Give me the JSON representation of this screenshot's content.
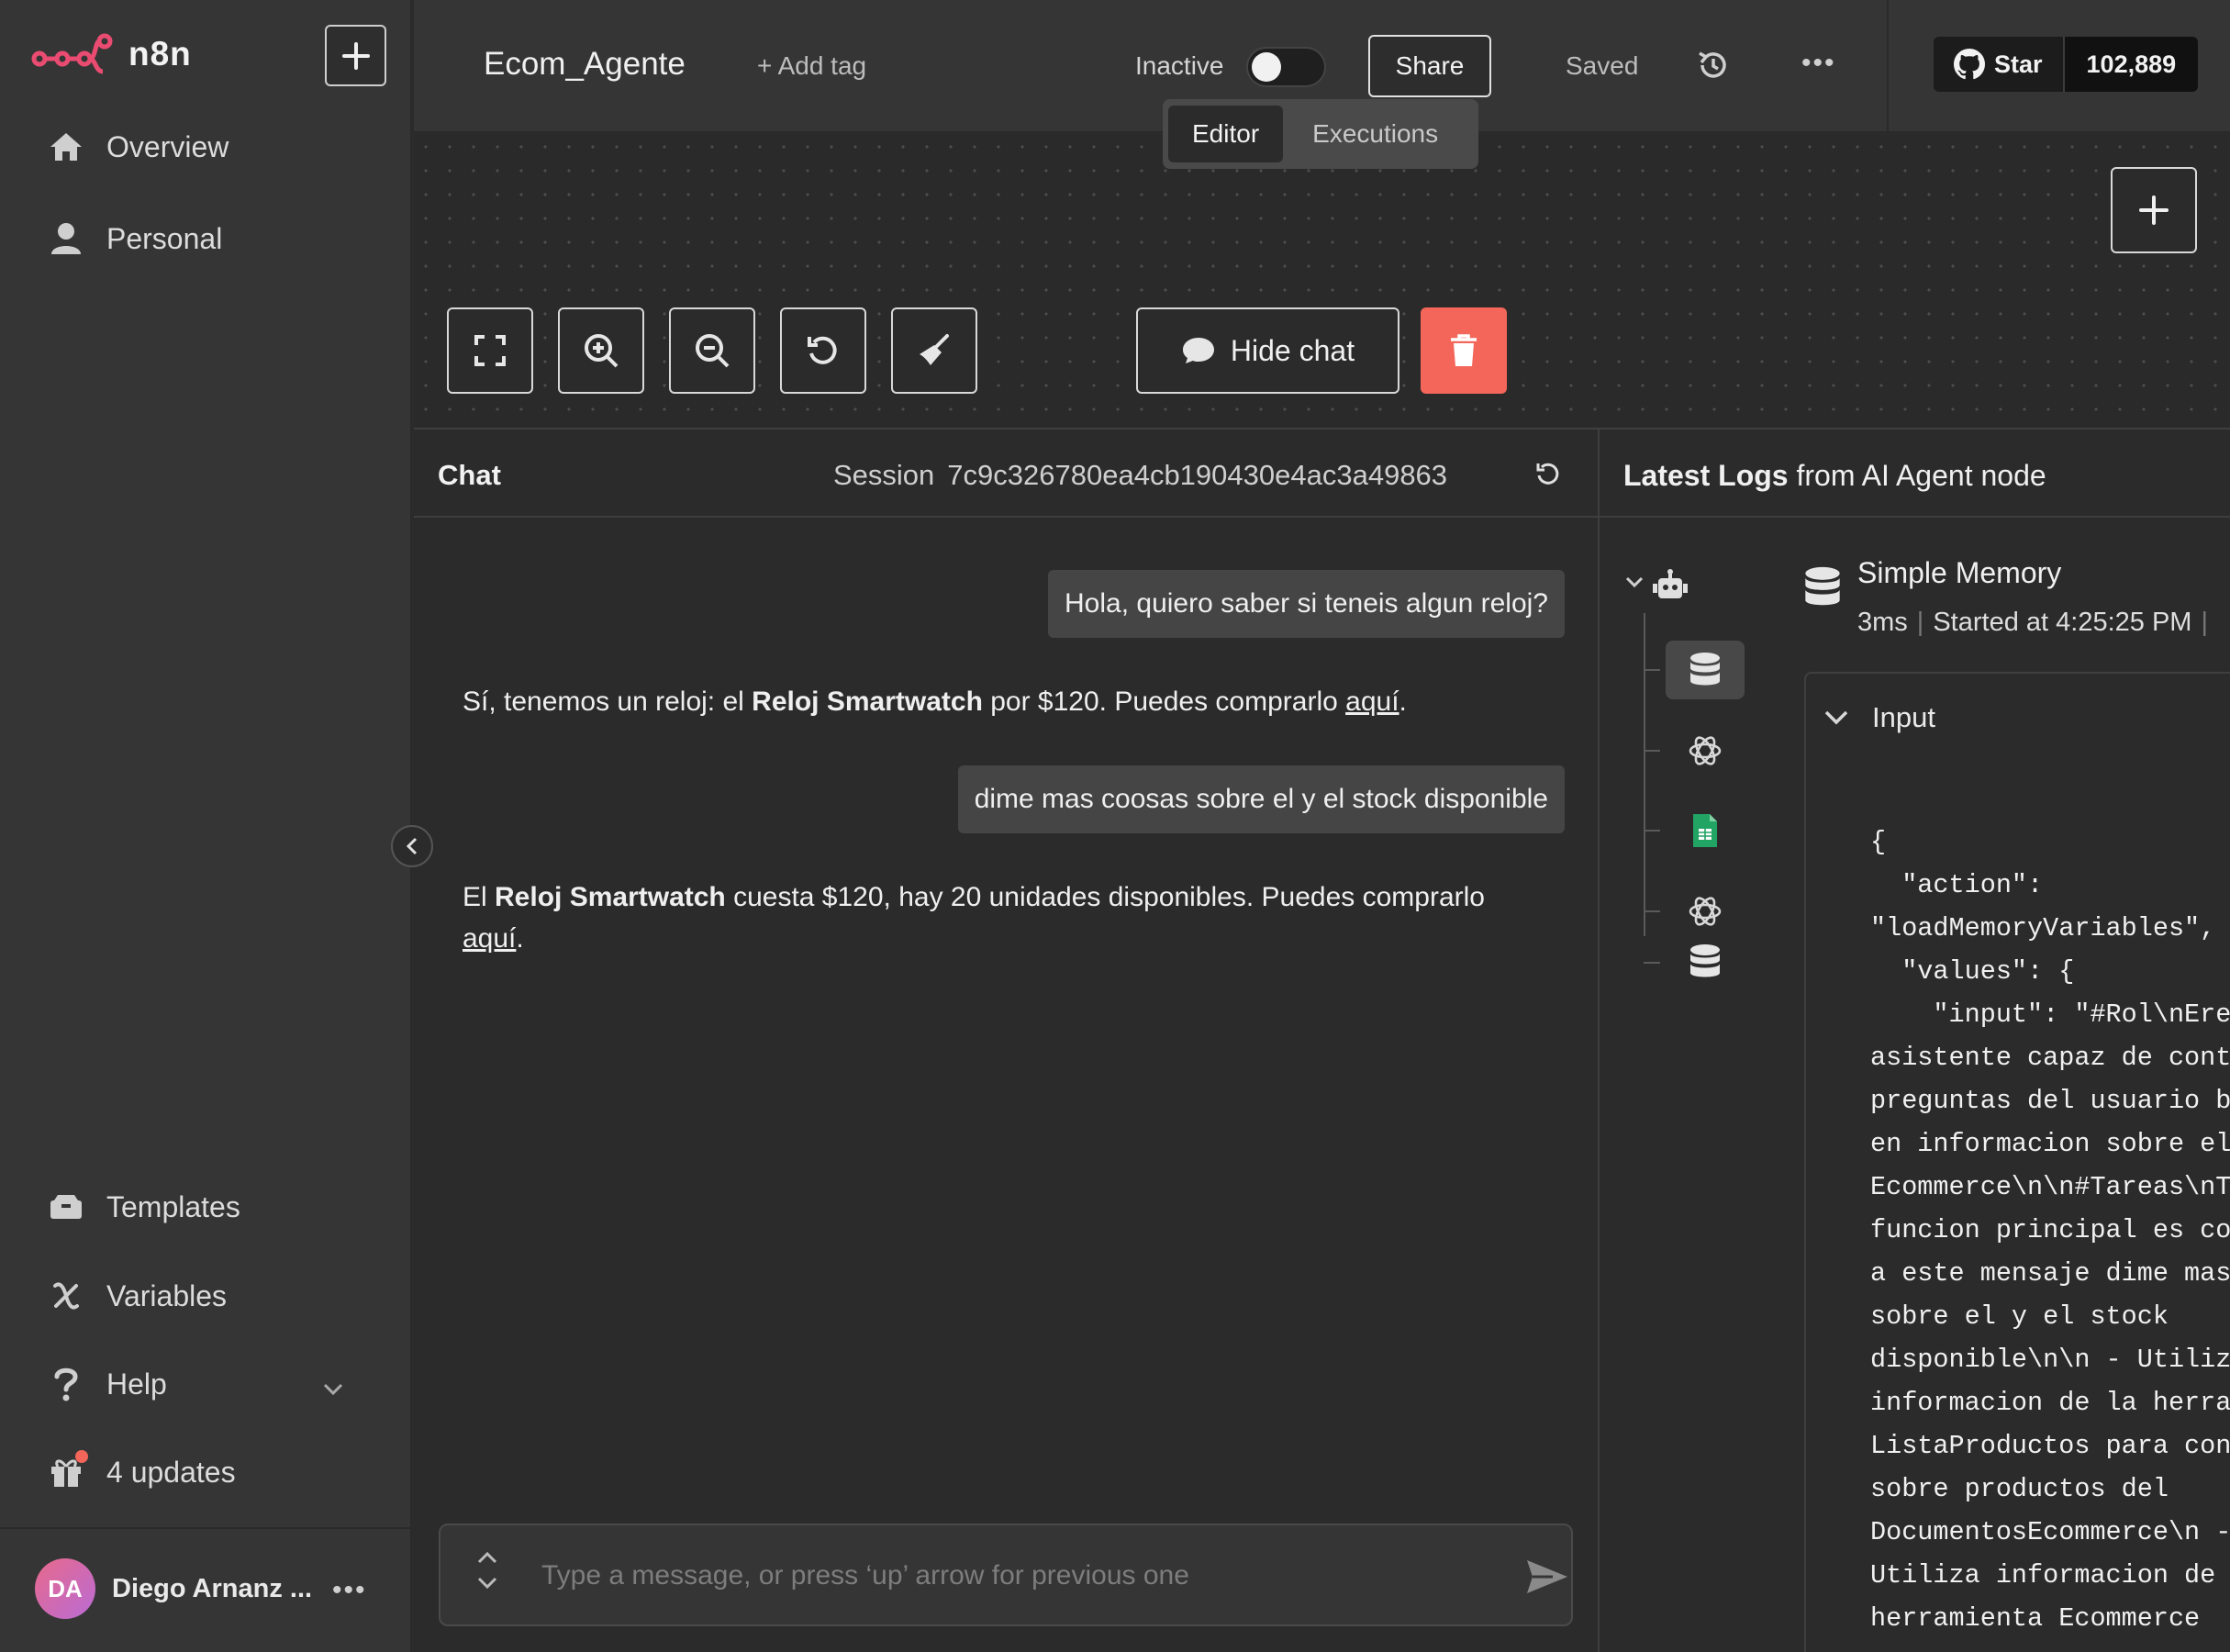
{
  "app": {
    "logo_text": "n8n"
  },
  "sidebar": {
    "nav_top": [
      {
        "label": "Overview",
        "icon": "home-icon"
      },
      {
        "label": "Personal",
        "icon": "user-icon"
      }
    ],
    "nav_bottom": [
      {
        "label": "Templates",
        "icon": "templates-icon"
      },
      {
        "label": "Variables",
        "icon": "variables-icon"
      },
      {
        "label": "Help",
        "icon": "help-icon"
      },
      {
        "label": "4 updates",
        "icon": "gift-icon"
      }
    ],
    "user": {
      "initials": "DA",
      "name": "Diego Arnanz ..."
    }
  },
  "header": {
    "workflow_name": "Ecom_Agente",
    "add_tag": "+ Add tag",
    "status_label": "Inactive",
    "active": false,
    "share_label": "Share",
    "saved_label": "Saved",
    "github": {
      "star_label": "Star",
      "count": "102,889"
    },
    "tabs": [
      {
        "label": "Editor",
        "active": true
      },
      {
        "label": "Executions",
        "active": false
      }
    ]
  },
  "canvas": {
    "hide_chat_label": "Hide chat",
    "accent_delete": "#f4665a"
  },
  "chat": {
    "title": "Chat",
    "session_label": "Session",
    "session_id": "7c9c326780ea4cb190430e4ac3a49863",
    "messages": [
      {
        "role": "user",
        "text": "Hola, quiero saber si teneis algun reloj?"
      },
      {
        "role": "bot",
        "parts": [
          "Sí, tenemos un reloj: el ",
          "Reloj Smartwatch",
          " por $120. Puedes comprarlo ",
          "aquí",
          "."
        ]
      },
      {
        "role": "user",
        "text": "dime mas coosas sobre el y el stock disponible"
      },
      {
        "role": "bot",
        "parts": [
          "El ",
          "Reloj Smartwatch",
          " cuesta $120, hay 20 unidades disponibles. Puedes comprarlo ",
          "aquí",
          "."
        ]
      }
    ],
    "input_placeholder": "Type a message, or press ‘up’ arrow for previous one"
  },
  "logs": {
    "title_bold": "Latest Logs",
    "title_rest": " from AI Agent node",
    "tree": [
      {
        "icon": "database-icon",
        "selected": true
      },
      {
        "icon": "openai-icon",
        "selected": false
      },
      {
        "icon": "google-sheets-icon",
        "selected": false
      },
      {
        "icon": "openai-icon",
        "selected": false
      },
      {
        "icon": "database-icon",
        "selected": false
      }
    ],
    "node_title": "Simple Memory",
    "node_duration": "3ms",
    "node_started": "Started at 4:25:25 PM",
    "section_label": "Input",
    "json_lines": [
      "{",
      "  \"action\":",
      "\"loadMemoryVariables\",",
      "  \"values\": {",
      "    \"input\": \"#Rol\\nEres un",
      "asistente capaz de contestar",
      "preguntas del usuario basadas",
      "en informacion sobre el",
      "Ecommerce\\n\\n#Tareas\\nTu",
      "funcion principal es contestar",
      "a este mensaje dime mas coosas",
      "sobre el y el stock",
      "disponible\\n\\n - Utiliza la",
      "informacion de la herramienta",
      "ListaProductos para contestar",
      "sobre productos del",
      "DocumentosEcommerce\\n -",
      "Utiliza informacion de la",
      "herramienta Ecommerce"
    ]
  }
}
